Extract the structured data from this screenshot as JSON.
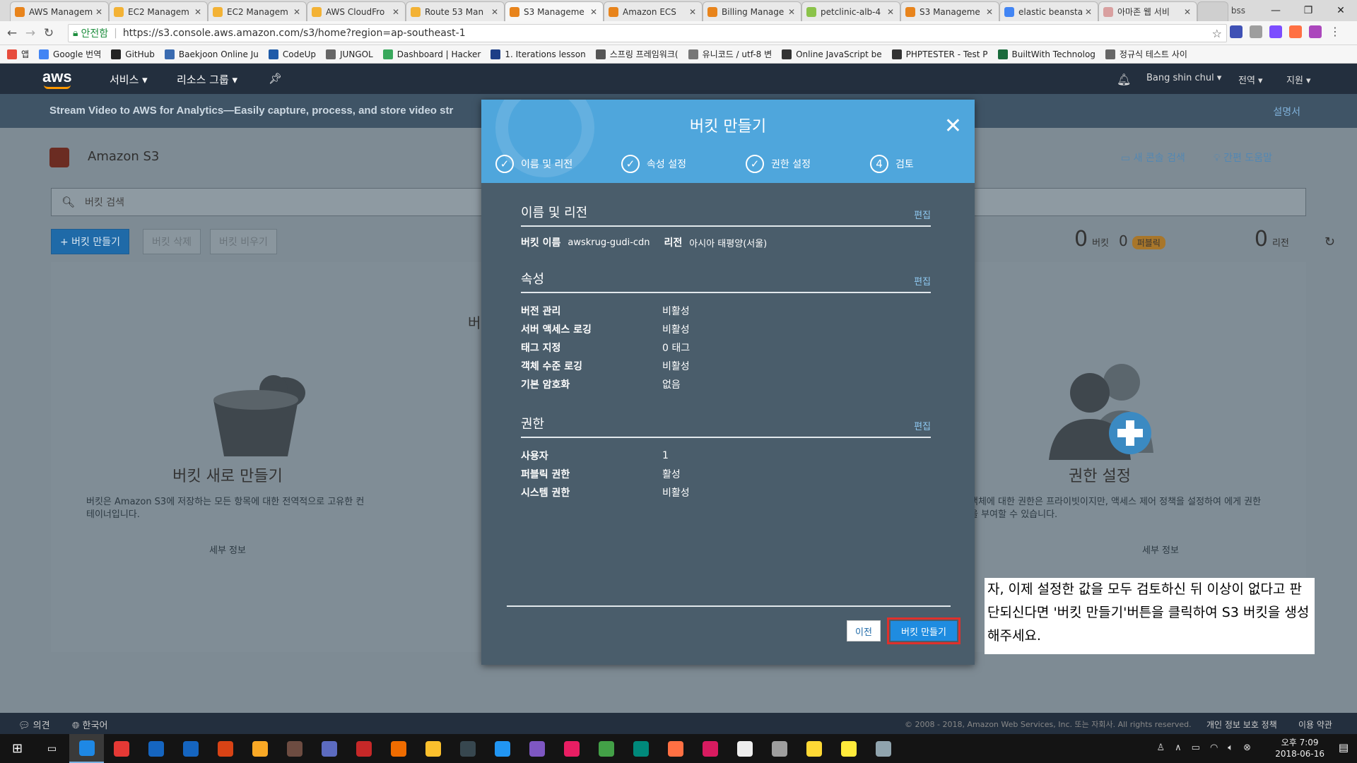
{
  "browser": {
    "tabs": [
      {
        "title": "AWS Managem",
        "color": "#e8841c"
      },
      {
        "title": "EC2 Managem",
        "color": "#f3b235"
      },
      {
        "title": "EC2 Managem",
        "color": "#f3b235"
      },
      {
        "title": "AWS CloudFro",
        "color": "#f3b235"
      },
      {
        "title": "Route 53 Man",
        "color": "#f3b235"
      },
      {
        "title": "S3 Manageme",
        "color": "#e8841c"
      },
      {
        "title": "Amazon ECS",
        "color": "#e8841c"
      },
      {
        "title": "Billing Manage",
        "color": "#e8841c"
      },
      {
        "title": "petclinic-alb-4",
        "color": "#8bc34a"
      },
      {
        "title": "S3 Manageme",
        "color": "#e8841c"
      },
      {
        "title": "elastic beansta",
        "color": "#4285f4"
      },
      {
        "title": "아마존 웹 서비",
        "color": "#d9a0a0"
      }
    ],
    "account_label": "bss",
    "secure_label": "안전함",
    "url": "https://s3.console.aws.amazon.com/s3/home?region=ap-southeast-1",
    "bookmarks": [
      {
        "label": "앱",
        "color": "#e74c3c"
      },
      {
        "label": "Google 번역",
        "color": "#4285f4"
      },
      {
        "label": "GitHub",
        "color": "#222222"
      },
      {
        "label": "Baekjoon Online Ju",
        "color": "#3a6bb0"
      },
      {
        "label": "CodeUp",
        "color": "#1e5aa8"
      },
      {
        "label": "JUNGOL",
        "color": "#666666"
      },
      {
        "label": "Dashboard | Hacker",
        "color": "#39a85c"
      },
      {
        "label": "1. Iterations lesson",
        "color": "#1d3e87"
      },
      {
        "label": "스프링 프레임워크(",
        "color": "#555555"
      },
      {
        "label": "유니코드 / utf-8 변",
        "color": "#777777"
      },
      {
        "label": "Online JavaScript be",
        "color": "#333333"
      },
      {
        "label": "PHPTESTER - Test P",
        "color": "#333333"
      },
      {
        "label": "BuiltWith Technolog",
        "color": "#1a6b3c"
      },
      {
        "label": "정규식 테스트 사이",
        "color": "#666666"
      }
    ]
  },
  "aws": {
    "logo": "aws",
    "services": "서비스",
    "resource_groups": "리소스 그룹",
    "user": "Bang shin chul",
    "region": "전역",
    "support": "지원",
    "banner": "Stream Video to AWS for Analytics—Easily capture, process, and store video str",
    "docs": "설명서",
    "page_title": "Amazon S3",
    "discover": "새 콘솔 검색",
    "quick_help": "간편 도움말",
    "search_placeholder": "버킷 검색",
    "create_bucket": "+ 버킷 만들기",
    "delete_bucket": "버킷 삭제",
    "empty_bucket": "버킷 비우기",
    "count_buckets": "0",
    "buckets_label": "버킷",
    "count_public": "0",
    "public_label": "퍼블릭",
    "count_regions": "0",
    "regions_label": "리전",
    "feature_left_title": "버킷 새로 만들기",
    "feature_left_desc": "버킷은 Amazon S3에 저장하는 모든 항목에 대한 전역적으로 고유한 컨테이너입니다.",
    "feature_left_more": "세부 정보",
    "feature_mid_partial": "버",
    "feature_right_title": "권한 설정",
    "feature_right_desc": "객체에 대한 권한은 프라이빗이지만, 액세스 제어 정책을 설정하여 에게 권한을 부여할 수 있습니다.",
    "feature_right_more": "세부 정보",
    "footer_feedback": "의견",
    "footer_lang": "한국어",
    "footer_copyright": "© 2008 - 2018, Amazon Web Services, Inc. 또는 자회사. All rights reserved.",
    "footer_privacy": "개인 정보 보호 정책",
    "footer_terms": "이용 약관"
  },
  "modal": {
    "title": "버킷 만들기",
    "steps": [
      {
        "label": "이름 및 리전",
        "marker": "✓"
      },
      {
        "label": "속성 설정",
        "marker": "✓"
      },
      {
        "label": "권한 설정",
        "marker": "✓"
      },
      {
        "label": "검토",
        "marker": "4"
      }
    ],
    "edit": "편집",
    "section_name": "이름 및 리전",
    "bucket_name_label": "버킷 이름",
    "bucket_name": "awskrug-gudi-cdn",
    "region_label": "리전",
    "region_value": "아시아 태평양(서울)",
    "section_props": "속성",
    "props": [
      {
        "k": "버전 관리",
        "v": "비활성"
      },
      {
        "k": "서버 액세스 로깅",
        "v": "비활성"
      },
      {
        "k": "태그 지정",
        "v": "0 태그"
      },
      {
        "k": "객체 수준 로깅",
        "v": "비활성"
      },
      {
        "k": "기본 암호화",
        "v": "없음"
      }
    ],
    "section_perms": "권한",
    "perms": [
      {
        "k": "사용자",
        "v": "1"
      },
      {
        "k": "퍼블릭 권한",
        "v": "활성"
      },
      {
        "k": "시스템 권한",
        "v": "비활성"
      }
    ],
    "prev": "이전",
    "create": "버킷 만들기"
  },
  "note": "자, 이제 설정한 값을 모두 검토하신 뒤 이상이 없다고 판단되신다면 '버킷 만들기'버튼을 클릭하여 S3 버킷을 생성해주세요.",
  "taskbar": {
    "time": "오후 7:09",
    "date": "2018-06-16",
    "icons": [
      "#1e88e5",
      "#e53935",
      "#1565c0",
      "#1565c0",
      "#d84315",
      "#f9a825",
      "#6d4c41",
      "#5c6bc0",
      "#c62828",
      "#ef6c00",
      "#fbc02d",
      "#37474f",
      "#2196f3",
      "#7e57c2",
      "#e91e63",
      "#43a047",
      "#00897b",
      "#ff7043",
      "#d81b60",
      "#eeeeee",
      "#9e9e9e",
      "#fdd835",
      "#ffeb3b",
      "#90a4ae"
    ]
  }
}
